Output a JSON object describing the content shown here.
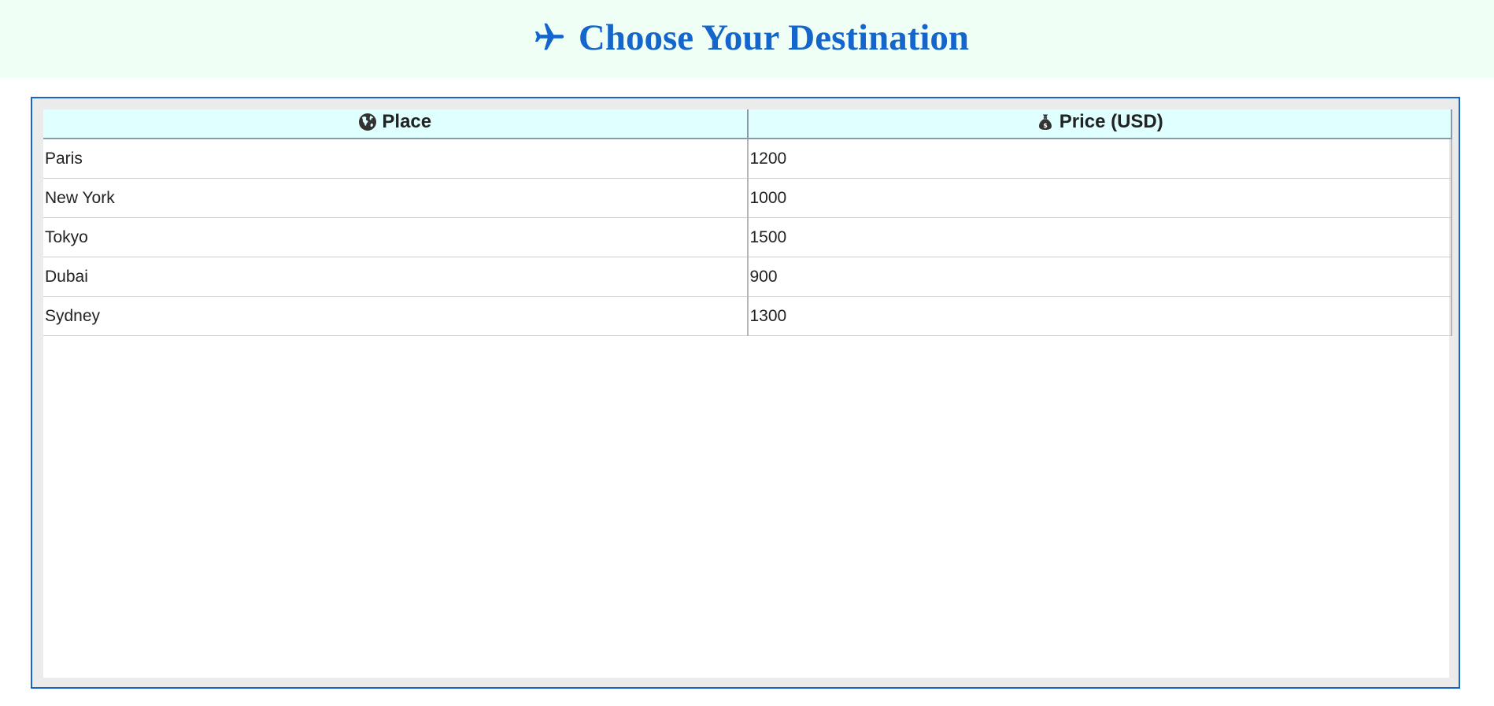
{
  "header": {
    "title": "Choose Your Destination",
    "icon": "airplane-icon",
    "title_color": "#1466cc",
    "background": "#f0fff6"
  },
  "table": {
    "columns": [
      {
        "label": "Place",
        "icon": "globe-icon"
      },
      {
        "label": "Price (USD)",
        "icon": "money-bag-icon"
      }
    ],
    "rows": [
      {
        "place": "Paris",
        "price": "1200"
      },
      {
        "place": "New York",
        "price": "1000"
      },
      {
        "place": "Tokyo",
        "price": "1500"
      },
      {
        "place": "Dubai",
        "price": "900"
      },
      {
        "place": "Sydney",
        "price": "1300"
      }
    ],
    "header_background": "#e0ffff",
    "frame_border": "#1466cc"
  }
}
